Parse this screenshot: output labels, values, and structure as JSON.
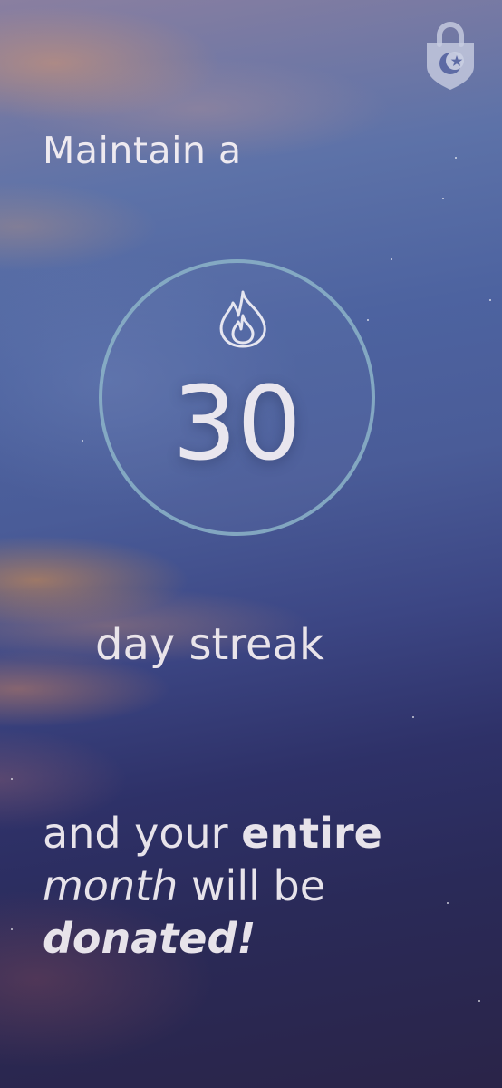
{
  "screen": {
    "heading_top": "Maintain a",
    "streak": {
      "number": "30",
      "icon": "flame-icon"
    },
    "heading_mid": "day streak",
    "reward": {
      "line1_prefix": "and your",
      "line1_bold": "entire",
      "line2_italic": "month",
      "line2_rest": "will be",
      "line3_bold_italic": "donated!"
    },
    "logo_icon": "lock-crescent-star-icon"
  },
  "colors": {
    "text": "#eeeaf0",
    "ring": "#8cb4c8",
    "sky_top": "#8a7fa0",
    "sky_mid": "#4d63a0",
    "sky_bottom": "#2a2448",
    "sunset_accent": "#e69646"
  }
}
